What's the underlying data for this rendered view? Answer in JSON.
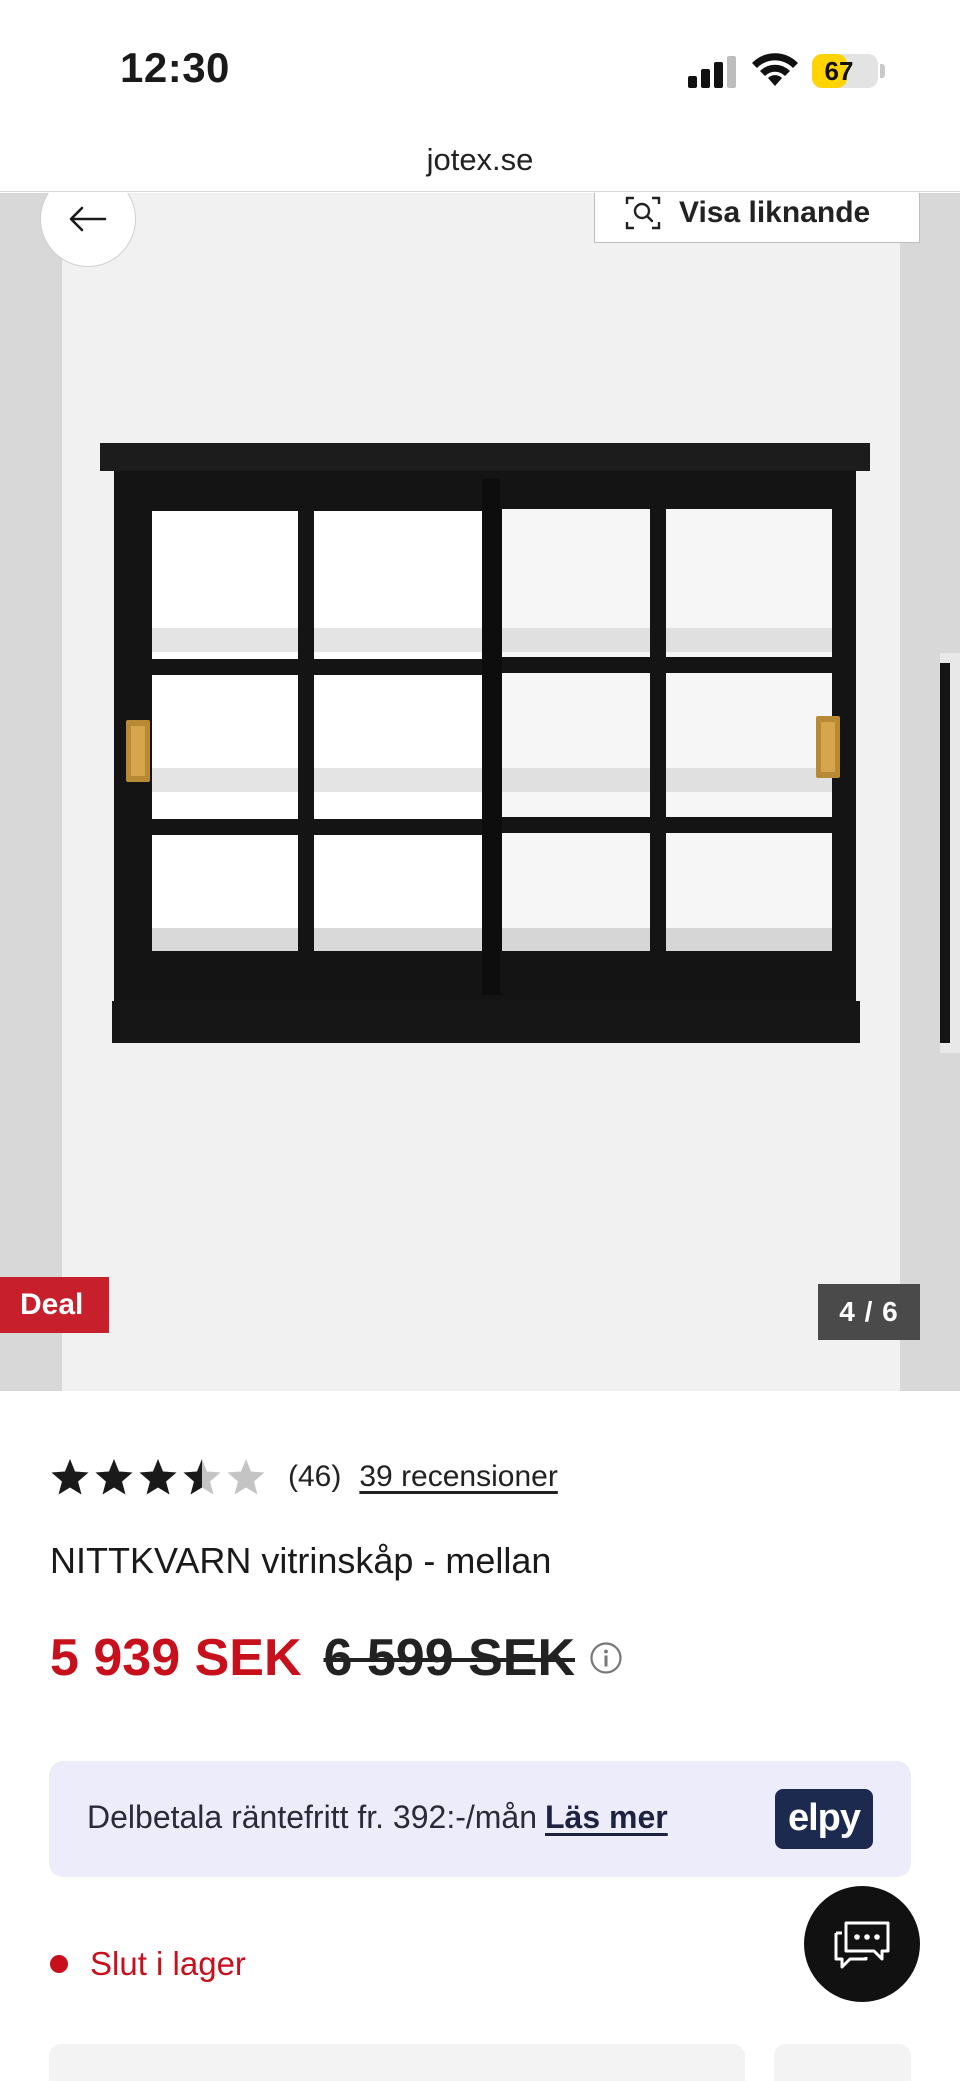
{
  "status_bar": {
    "time": "12:30",
    "battery_percent": 67,
    "battery_label": "67"
  },
  "browser": {
    "url": "jotex.se"
  },
  "gallery": {
    "similar_label": "Visa liknande",
    "deal_label": "Deal",
    "counter": "4 / 6",
    "current_image": 4,
    "total_images": 6
  },
  "product": {
    "rating": 3.5,
    "rating_max": 5,
    "review_count": "(46)",
    "reviews_link": "39 recensioner",
    "title": "NITTKVARN vitrinskåp - mellan",
    "price_now": "5 939 SEK",
    "price_old": "6 599 SEK",
    "stock_status": "Slut i lager"
  },
  "installment": {
    "text": "Delbetala räntefritt fr. 392:-/mån",
    "link": "Läs mer",
    "logo": "elpy"
  },
  "colors": {
    "accent_red": "#c7101c",
    "deal_red": "#c7202c",
    "installment_bg": "#ececfa",
    "elpy_navy": "#1d2a4f",
    "battery_yellow": "#ffd400"
  },
  "icons": {
    "back": "arrow-left-icon",
    "similar": "image-search-icon",
    "info": "info-icon",
    "chat": "chat-bubble-icon"
  }
}
